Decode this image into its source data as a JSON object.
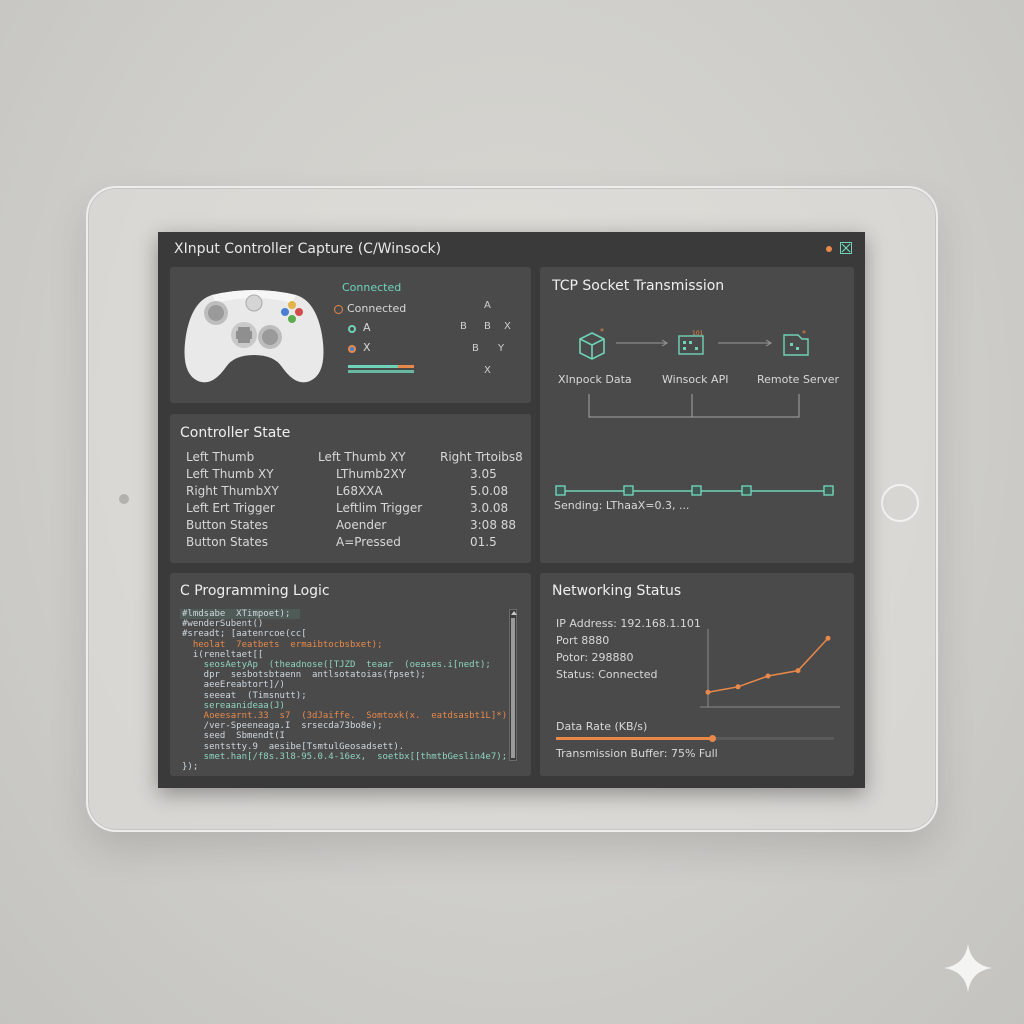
{
  "window": {
    "title": "XInput Controller Capture (C/Winsock)"
  },
  "controller_panel": {
    "status_heading": "Connected",
    "status_line": "Connected",
    "button_a": "A",
    "button_x": "X",
    "face_buttons": {
      "top": "A",
      "left": "B",
      "center": "B",
      "right": "X",
      "lower_left": "B",
      "lower_right": "Y",
      "bottom": "X"
    },
    "colors": {
      "accent": "#6fd3b8",
      "status_ring": "#e8894a"
    }
  },
  "tcp": {
    "title": "TCP Socket Transmission",
    "nodes": [
      "XInpock Data",
      "Winsock API",
      "Remote Server"
    ],
    "sending": "Sending: LThaaX=0.3, ..."
  },
  "state": {
    "title": "Controller State",
    "rows": [
      [
        "Left Thumb",
        "Left Thumb XY",
        "Right Trtoibs8"
      ],
      [
        "Left Thumb XY",
        "LThumb2XY",
        "3.05"
      ],
      [
        "Right ThumbXY",
        "L68XXA",
        "5.0.08"
      ],
      [
        "Left Ert Trigger",
        "Leftlim Trigger",
        "3.0.08"
      ],
      [
        "Button States",
        "Aoender",
        "3:08 88"
      ],
      [
        "Button States",
        "A=Pressed",
        "01.5"
      ]
    ]
  },
  "code": {
    "title": "C Programming Logic",
    "lines": [
      "#lmdsabe  XTimpoet);",
      "#wenderSubent()",
      "#sreadt; [aatenrcoe(cc[",
      "  heolat  7eatbets  ermaibtocbsbxet);",
      "  i(reneltaet[[",
      "    seosAetyAp  (theadnose([TJZD  teaar  (oeases.i[nedt);",
      "    dpr  sesbotsbtaenn  antlsotatoias(fpset);",
      "    aeeEreabtort]/)",
      "    seeeat  (Timsnutt);",
      "    sereaanideaa(J)",
      "    Aoeesarnt.33  s7  (3dJaiffe.  Somtoxk(x.  eatdsasbt1L]*);",
      "    /ver-Speeneaga.I  srsecda73bo8e);",
      "    seed  Sbmendt(I",
      "    sentstty.9  aesibe[TsmtulGeosadsett).",
      "    smet.han[/f8s.3l8-95.0.4-16ex,  soetbx[[thmtbGeslin4e7);",
      "});"
    ]
  },
  "net": {
    "title": "Networking Status",
    "ip": "IP Address: 192.168.1.101",
    "port": "Port 8880",
    "potor": "Potor: 298880",
    "status": "Status: Connected",
    "data_rate_label": "Data Rate (KB/s)",
    "buffer": "Transmission Buffer: 75% Full",
    "buffer_fill": 0.56,
    "rate_series": [
      2,
      3,
      5,
      6,
      12
    ],
    "colors": {
      "line": "#e8894a"
    }
  }
}
